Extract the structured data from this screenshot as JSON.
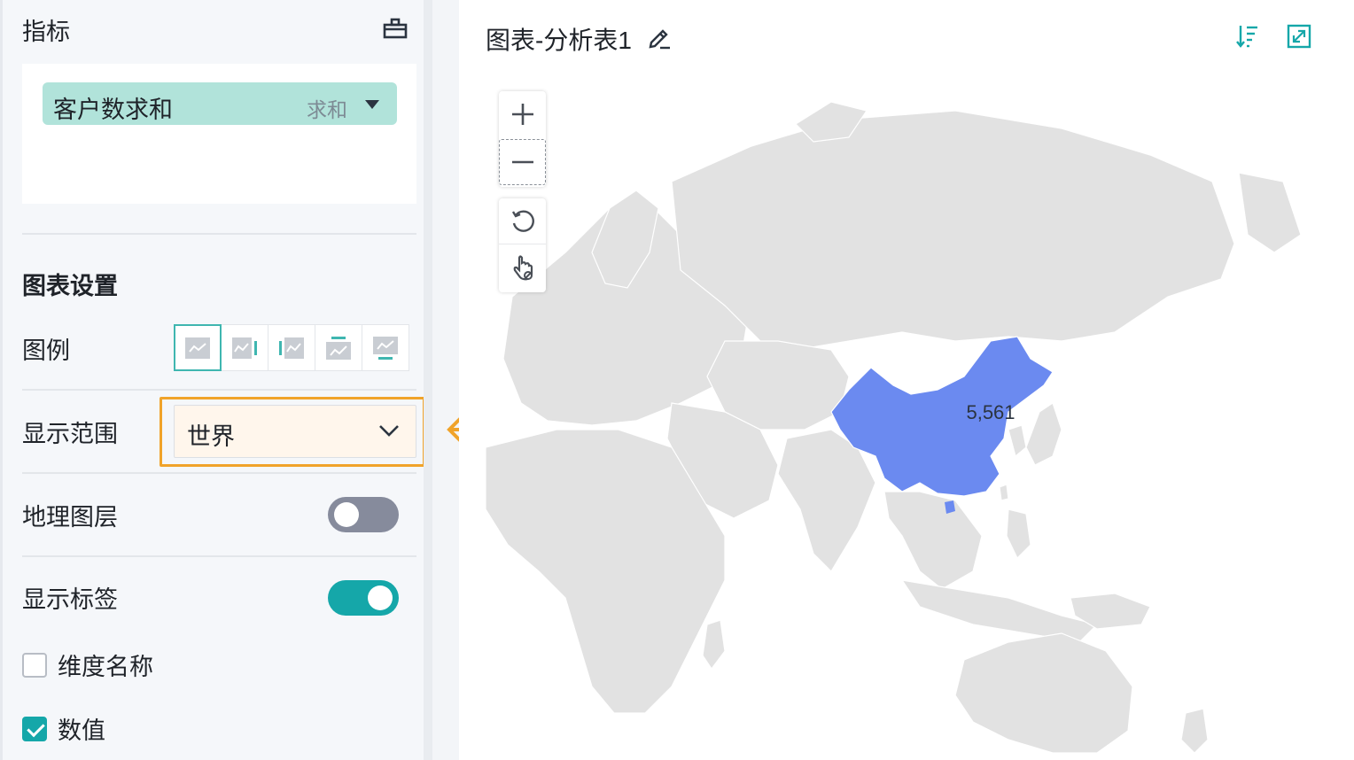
{
  "left_panel": {
    "metric_section": {
      "title": "指标",
      "tray_icon": "tray-icon"
    },
    "metric_field": {
      "name": "客户数求和",
      "aggregation": "求和",
      "caret_icon": "caret-down-icon"
    },
    "chart_settings": {
      "title": "图表设置",
      "legend": {
        "label": "图例",
        "options": [
          {
            "id": "none",
            "icon": "legend-none-icon",
            "active": true
          },
          {
            "id": "right",
            "icon": "legend-right-icon",
            "active": false
          },
          {
            "id": "left",
            "icon": "legend-left-icon",
            "active": false
          },
          {
            "id": "top",
            "icon": "legend-top-icon",
            "active": false
          },
          {
            "id": "bottom",
            "icon": "legend-bottom-icon",
            "active": false
          }
        ]
      },
      "display_range": {
        "label": "显示范围",
        "value": "世界",
        "icon": "chevron-down-icon"
      },
      "geo_layer": {
        "label": "地理图层",
        "enabled": false
      },
      "show_labels": {
        "label": "显示标签",
        "enabled": true
      },
      "dimension_name": {
        "label": "维度名称",
        "checked": false
      },
      "value": {
        "label": "数值",
        "checked": true
      }
    }
  },
  "chart": {
    "title": "图表-分析表1",
    "edit_icon": "edit-icon",
    "sort_icon": "sort-icon",
    "expand_icon": "expand-icon",
    "map_controls": [
      "zoom-in-icon",
      "zoom-out-icon",
      "reset-icon",
      "pointer-icon"
    ],
    "highlight_color": "#6b8af0",
    "land_color": "#e2e2e2",
    "highlight_region_label": "5,561"
  },
  "colors": {
    "accent": "#15a7a9",
    "highlight_border": "#f0a32a",
    "pill": "#b1e3da"
  }
}
